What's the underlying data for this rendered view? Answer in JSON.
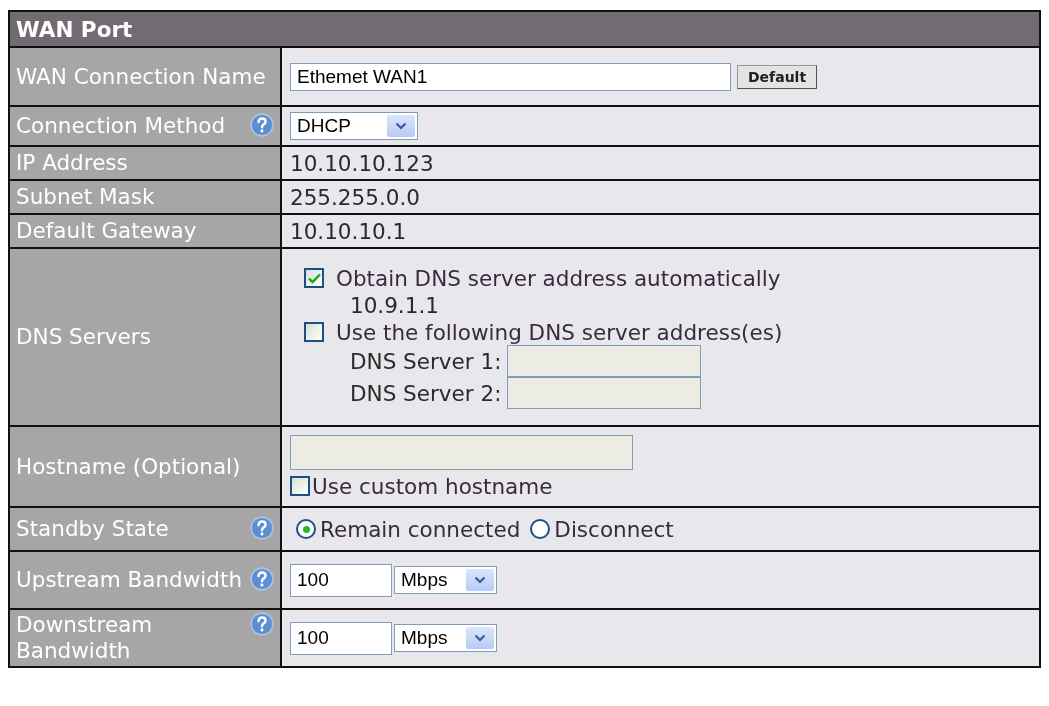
{
  "panel": {
    "title": "WAN Port",
    "rows": [
      {
        "kind": "text_input",
        "label": "WAN Connection Name",
        "help": false,
        "value": "Ethemet WAN1",
        "button": "Default"
      },
      {
        "kind": "select",
        "label": "Connection Method",
        "help": true,
        "value": "DHCP"
      },
      {
        "kind": "text",
        "label": "IP Address",
        "help": false,
        "value": "10.10.10.123"
      },
      {
        "kind": "text",
        "label": "Subnet Mask",
        "help": false,
        "value": "255.255.0.0"
      },
      {
        "kind": "text",
        "label": "Default Gateway",
        "help": false,
        "value": "10.10.10.1"
      },
      {
        "kind": "dns",
        "label": "DNS Servers",
        "help": false,
        "options": [
          {
            "label": "Obtain DNS server address automatically",
            "checked": true,
            "detail": "10.9.1.1"
          },
          {
            "label": "Use the following DNS server address(es)",
            "checked": false,
            "servers": [
              {
                "label": "DNS Server 1:"
              },
              {
                "label": "DNS Server 2:"
              }
            ]
          }
        ]
      },
      {
        "kind": "hostname",
        "label": "Hostname (Optional)",
        "help": false,
        "checkbox": {
          "label": "Use custom hostname",
          "checked": false
        }
      },
      {
        "kind": "radio",
        "label": "Standby State",
        "help": true,
        "options": [
          {
            "label": "Remain connected",
            "selected": true
          },
          {
            "label": "Disconnect",
            "selected": false
          }
        ]
      },
      {
        "kind": "bandwidth",
        "label": "Upstream Bandwidth",
        "help": true,
        "value": "100",
        "unit": "Mbps"
      },
      {
        "kind": "bandwidth",
        "label": "Downstream Bandwidth",
        "help": true,
        "value": "100",
        "unit": "Mbps"
      }
    ]
  }
}
